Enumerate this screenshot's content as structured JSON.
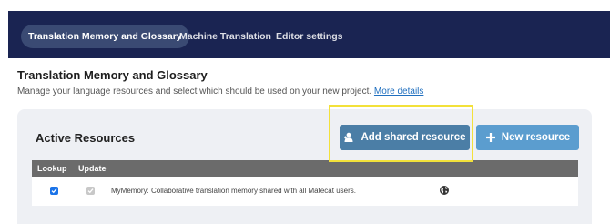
{
  "topbar": {
    "tabs": [
      {
        "label": "Translation Memory and Glossary",
        "active": true
      },
      {
        "label": "Machine Translation",
        "active": false
      },
      {
        "label": "Editor settings",
        "active": false
      }
    ]
  },
  "page": {
    "title": "Translation Memory and Glossary",
    "subtitle": "Manage your language resources and select which should be used on your new project.",
    "more_details_link": "More details"
  },
  "panel": {
    "title": "Active Resources",
    "add_shared_button": "Add shared resource",
    "new_resource_button": "New resource",
    "table": {
      "headers": [
        "Lookup",
        "Update"
      ],
      "rows": [
        {
          "lookup_checked": true,
          "update_checked": true,
          "update_disabled": true,
          "name": "MyMemory: Collaborative translation memory shared with all Matecat users.",
          "icon": "globe-icon"
        }
      ]
    }
  },
  "colors": {
    "topbar_bg": "#1a2452",
    "active_tab_bg": "#3a4a73",
    "add_button_bg": "#4b7ea6",
    "new_button_bg": "#5b9dcf",
    "highlight_border": "#f3e13a",
    "checkbox_checked": "#1a73e8"
  }
}
